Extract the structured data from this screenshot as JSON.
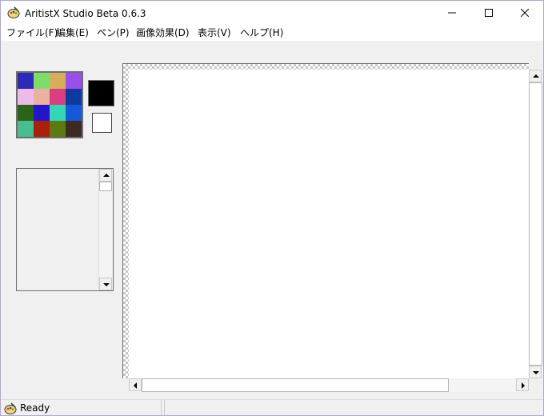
{
  "window": {
    "title": "AritistX Studio Beta 0.6.3"
  },
  "icons": {
    "app": "palette-icon",
    "minimize": "minimize-icon",
    "maximize": "maximize-icon",
    "close": "close-icon",
    "status": "palette-icon"
  },
  "menu": {
    "items": [
      {
        "label": "ファイル(F)"
      },
      {
        "label": "編集(E)"
      },
      {
        "label": "ペン(P)"
      },
      {
        "label": "画像効果(D)"
      },
      {
        "label": "表示(V)"
      },
      {
        "label": "ヘルプ(H)"
      }
    ]
  },
  "palette": {
    "colors": [
      "#2b2bb7",
      "#7fdc6a",
      "#d6ad5b",
      "#9a4fe8",
      "#eebbe8",
      "#eab0a0",
      "#d93e83",
      "#0e3a9e",
      "#2a6418",
      "#2515c9",
      "#36d6b4",
      "#1758d8",
      "#48bd8e",
      "#a72009",
      "#5c7912",
      "#3c2a24"
    ],
    "foreground": "#000000",
    "background": "#ffffff"
  },
  "status": {
    "text": "Ready"
  }
}
